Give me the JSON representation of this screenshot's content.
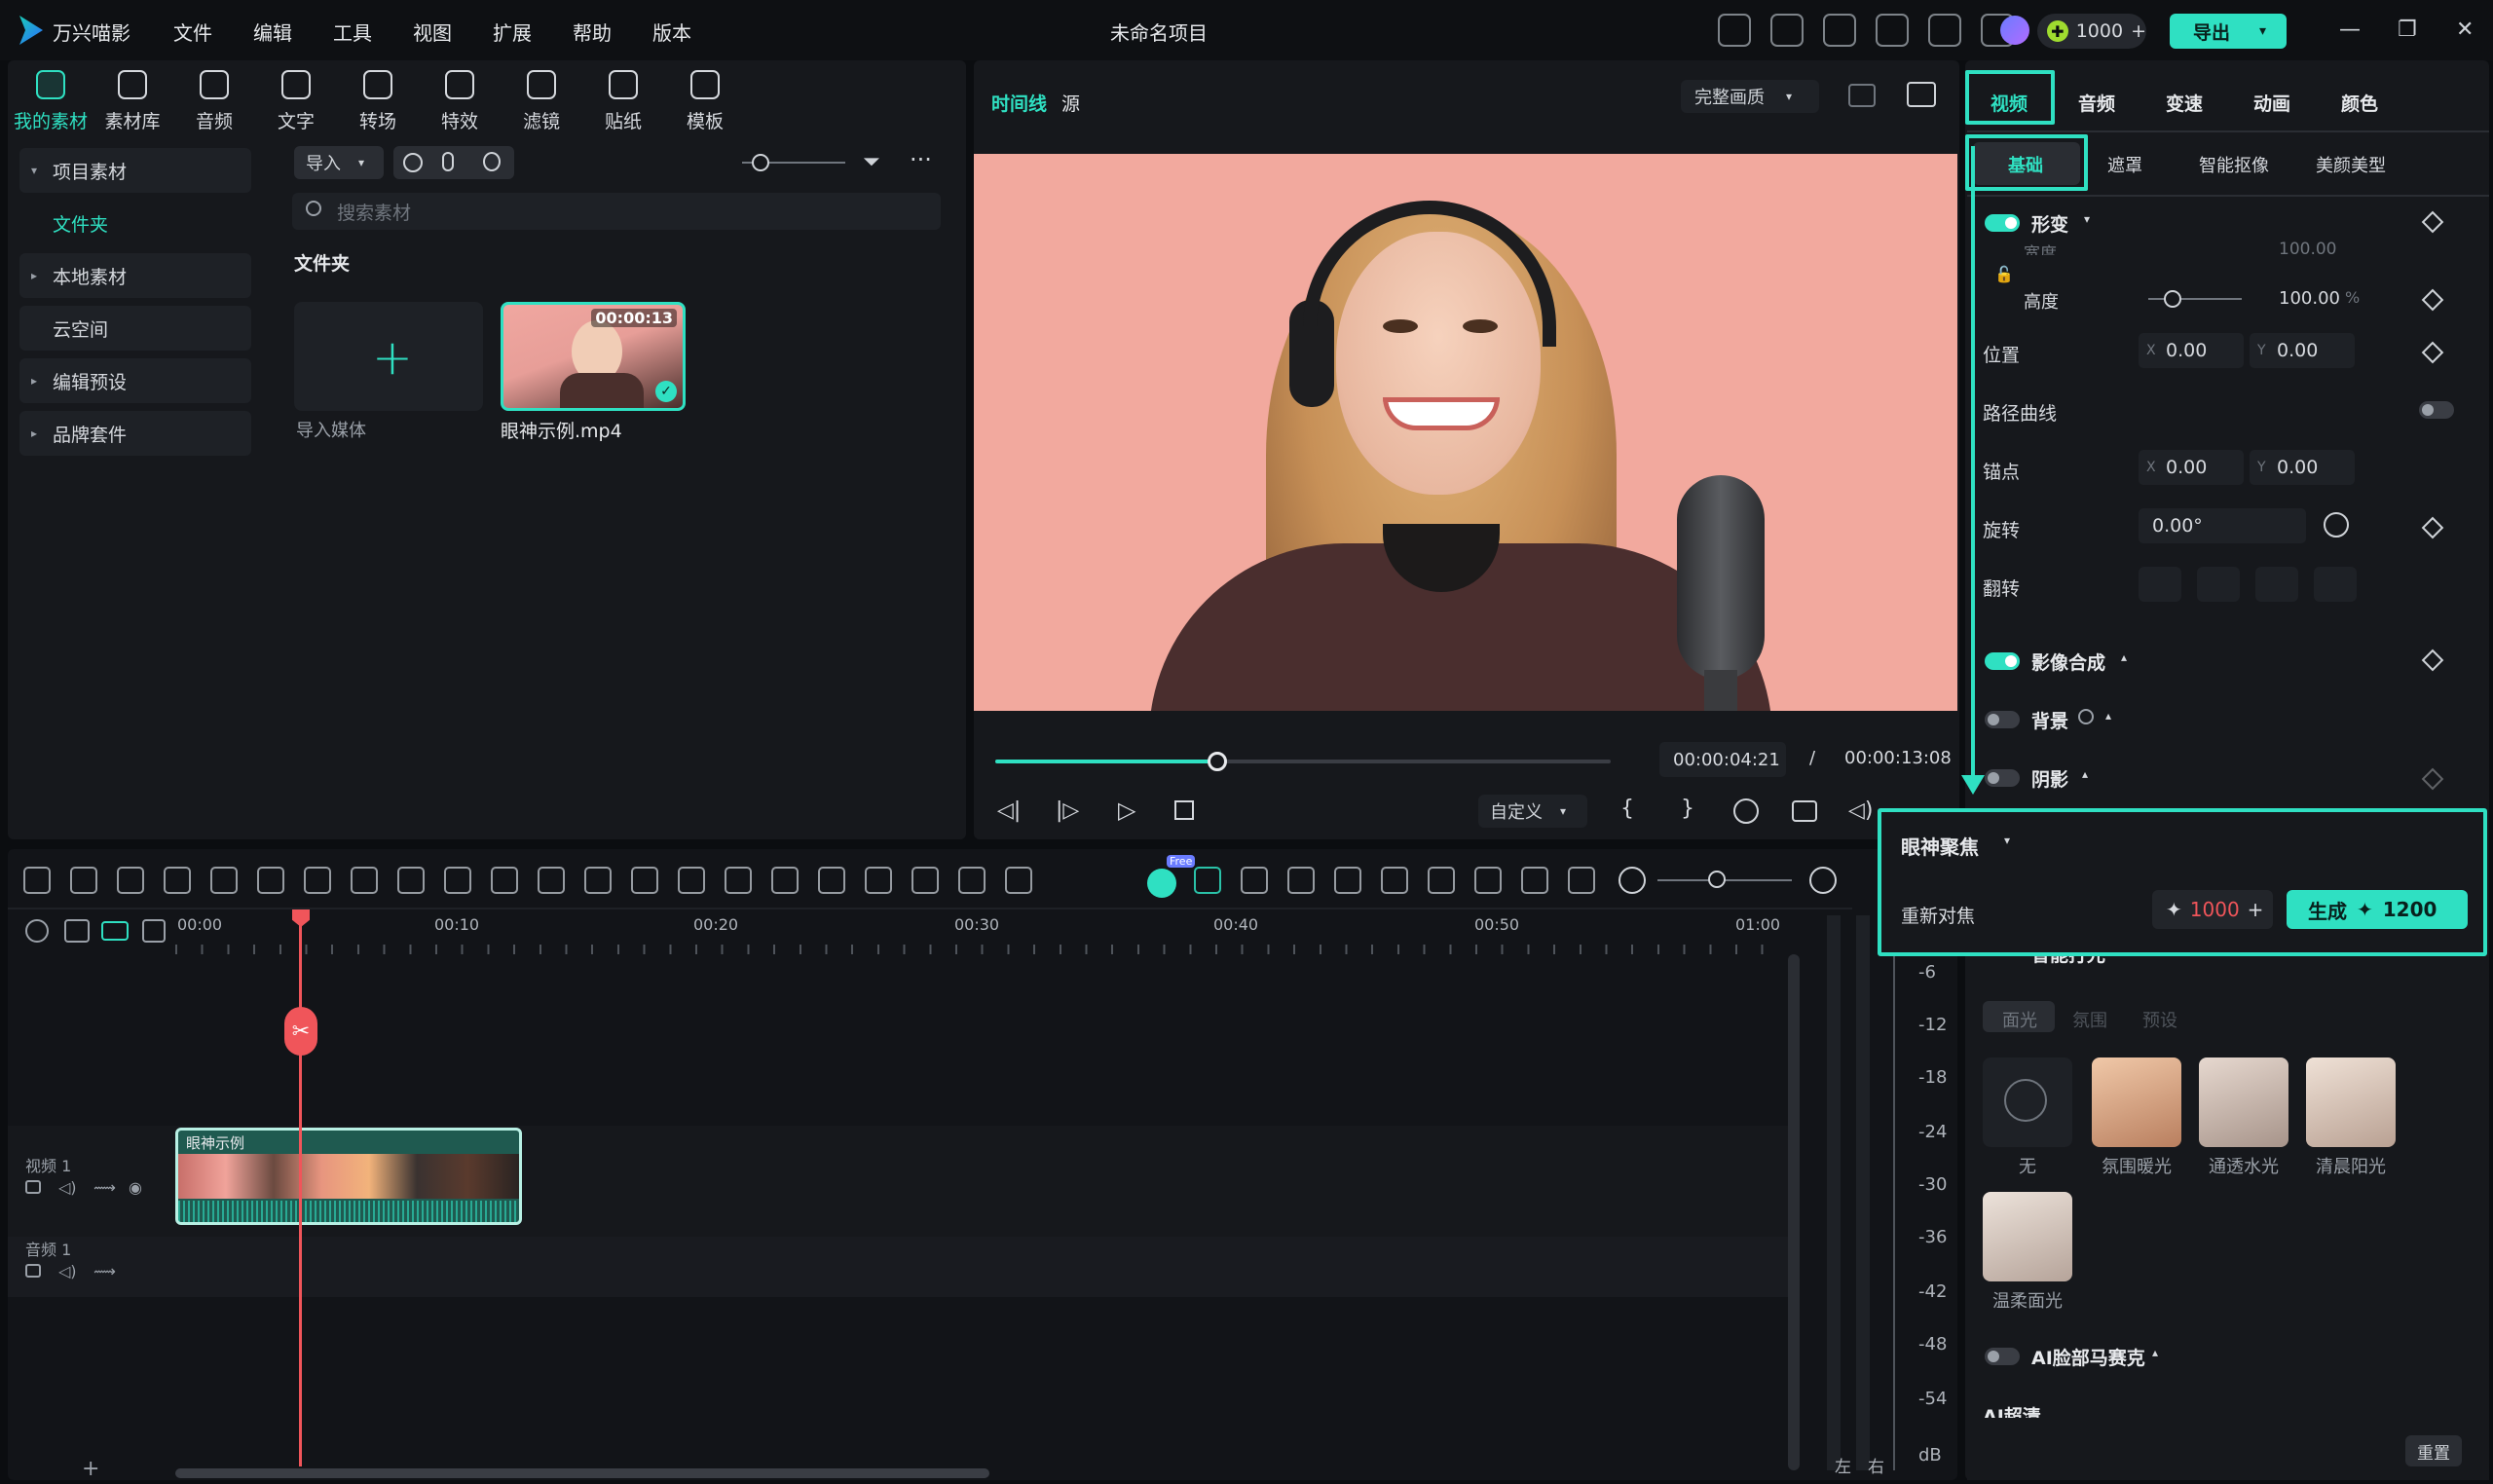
{
  "app": {
    "name": "万兴喵影",
    "project_title": "未命名项目"
  },
  "menu": [
    "文件",
    "编辑",
    "工具",
    "视图",
    "扩展",
    "帮助",
    "版本"
  ],
  "titlebar": {
    "credits": "1000",
    "export_label": "导出"
  },
  "media_tabs": [
    "我的素材",
    "素材库",
    "音频",
    "文字",
    "转场",
    "特效",
    "滤镜",
    "贴纸",
    "模板"
  ],
  "sidebar": {
    "items": [
      {
        "label": "项目素材",
        "arrow": "▾"
      },
      {
        "label": "文件夹",
        "arrow": ""
      },
      {
        "label": "本地素材",
        "arrow": "▸"
      },
      {
        "label": "云空间",
        "arrow": ""
      },
      {
        "label": "编辑预设",
        "arrow": "▸"
      },
      {
        "label": "品牌套件",
        "arrow": "▸"
      }
    ]
  },
  "library": {
    "import_label": "导入",
    "search_placeholder": "搜索素材",
    "folder_title": "文件夹",
    "import_media_label": "导入媒体",
    "clip_name": "眼神示例.mp4",
    "clip_duration": "00:00:13"
  },
  "player": {
    "tab_timeline": "时间线",
    "tab_source": "源",
    "quality": "完整画质",
    "current_time": "00:00:04:21",
    "separator": "/",
    "total_time": "00:00:13:08",
    "progress": 0.36,
    "custom_label": "自定义"
  },
  "right_panel": {
    "tabs": [
      "视频",
      "音频",
      "变速",
      "动画",
      "颜色"
    ],
    "subtabs": [
      "基础",
      "遮罩",
      "智能抠像",
      "美颜美型"
    ],
    "transform": "形变",
    "width_label": "宽度",
    "width_value": "100.00",
    "height_label": "高度",
    "height_value": "100.00",
    "percent": "%",
    "position_label": "位置",
    "pos_x": "0.00",
    "pos_y": "0.00",
    "path_curve": "路径曲线",
    "anchor_label": "锚点",
    "anchor_x": "0.00",
    "anchor_y": "0.00",
    "rotate_label": "旋转",
    "rotate_value": "0.00°",
    "flip_label": "翻转",
    "compositing": "影像合成",
    "background": "背景",
    "shadow": "阴影",
    "ax_x": "X",
    "ax_y": "Y",
    "smart_light": "智能打光",
    "light_tabs": [
      "面光",
      "氛围",
      "预设"
    ],
    "light_presets": [
      "无",
      "氛围暖光",
      "通透水光",
      "清晨阳光",
      "温柔面光"
    ],
    "ai_mosaic": "AI脸部马赛克",
    "ai_super": "AI超清",
    "reset": "重置"
  },
  "eye_focus": {
    "title": "眼神聚焦",
    "action_label": "重新对焦",
    "cost": "1000",
    "generate_label": "生成",
    "generate_cost": "1200"
  },
  "timeline": {
    "ruler": [
      "00:00",
      "00:10",
      "00:20",
      "00:30",
      "00:40",
      "00:50",
      "01:00"
    ],
    "video_track": "视频 1",
    "audio_track": "音频 1",
    "clip_label": "眼神示例",
    "free_badge": "Free",
    "meter": [
      "-6",
      "-12",
      "-18",
      "-24",
      "-30",
      "-36",
      "-42",
      "-48",
      "-54",
      "dB"
    ],
    "meter_lr": [
      "左",
      "右"
    ]
  },
  "colors": {
    "accent": "#2fe0c2",
    "playhead": "#f0555a",
    "bg": "#16181c"
  }
}
